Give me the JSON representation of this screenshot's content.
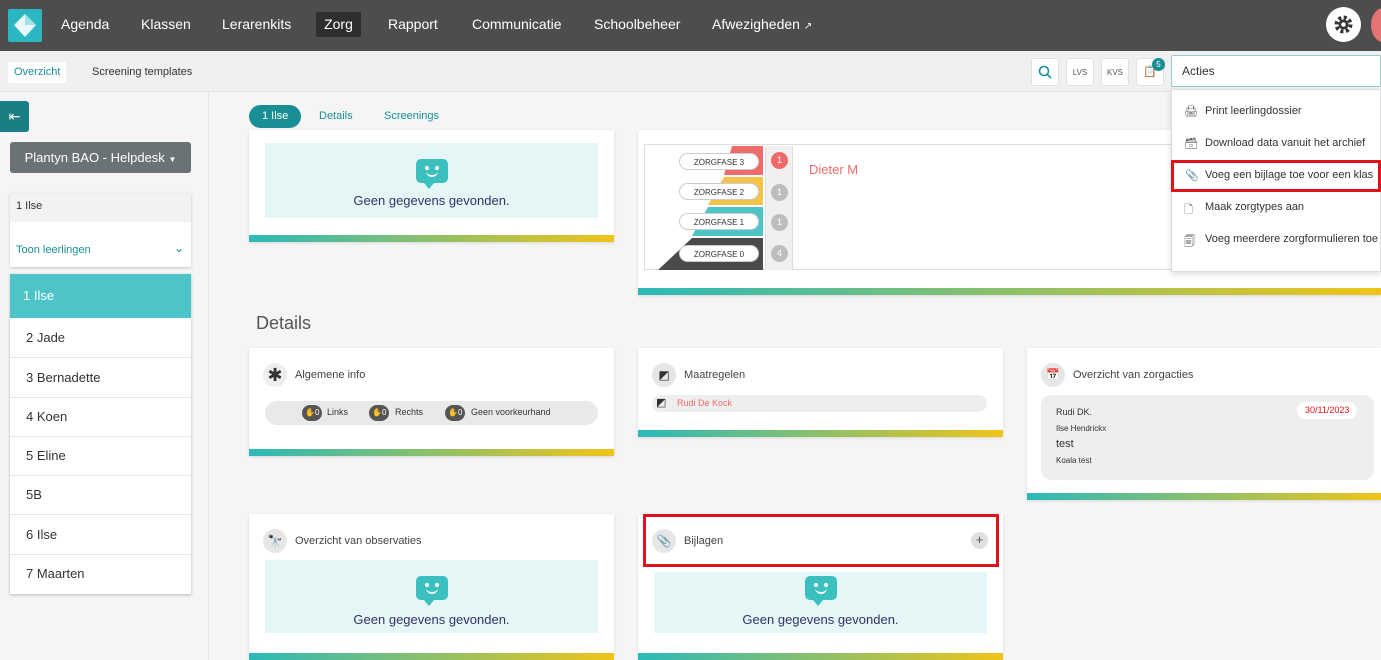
{
  "nav": {
    "items": [
      "Agenda",
      "Klassen",
      "Lerarenkits",
      "Zorg",
      "Rapport",
      "Communicatie",
      "Schoolbeheer",
      "Afwezigheden"
    ],
    "active": "Zorg",
    "external_icon": "external-link-icon"
  },
  "subnav": {
    "tabs": [
      "Overzicht",
      "Screening templates"
    ],
    "active": "Overzicht",
    "icons": {
      "search": "search-icon",
      "lvs": "LVS",
      "kvs": "KVS",
      "doc": "clipboard-icon"
    },
    "badge_count": "5",
    "acties_label": "Acties"
  },
  "acties_menu": {
    "items": [
      {
        "label": "Print leerlingdossier",
        "icon": "printer-icon"
      },
      {
        "label": "Download data vanuit het archief",
        "icon": "archive-icon"
      },
      {
        "label": "Voeg een bijlage toe voor een klas",
        "icon": "paperclip-icon",
        "highlighted": true
      },
      {
        "label": "Maak zorgtypes aan",
        "icon": "file-plus-icon"
      },
      {
        "label": "Voeg meerdere zorgformulieren toe",
        "icon": "files-icon"
      }
    ]
  },
  "sidebar": {
    "school": "Plantyn BAO - Helpdesk",
    "current_class": "1 Ilse",
    "toon_label": "Toon leerlingen",
    "classes": [
      "1 Ilse",
      "2 Jade",
      "3 Bernadette",
      "4 Koen",
      "5 Eline",
      "5B",
      "6 Ilse",
      "7 Maarten"
    ],
    "active_class": "1 Ilse"
  },
  "content_tabs": {
    "items": [
      "1 Ilse",
      "Details",
      "Screenings"
    ],
    "active": "1 Ilse"
  },
  "nodata_text": "Geen gegevens gevonden.",
  "pyramid": {
    "phases": [
      {
        "label": "ZORGFASE 3",
        "count": "1",
        "color": "#ef6b6b"
      },
      {
        "label": "ZORGFASE 2",
        "count": "1",
        "color": "#f3c34a"
      },
      {
        "label": "ZORGFASE 1",
        "count": "1",
        "color": "#4cc4c8"
      },
      {
        "label": "ZORGFASE 0",
        "count": "4",
        "color": "#4a4a4a"
      }
    ],
    "student": "Dieter M"
  },
  "details": {
    "section_title": "Details",
    "algemene": {
      "title": "Algemene info",
      "chips": [
        {
          "count": "0",
          "label": "Links"
        },
        {
          "count": "0",
          "label": "Rechts"
        },
        {
          "count": "0",
          "label": "Geen voorkeurhand"
        }
      ]
    },
    "maatregelen": {
      "title": "Maatregelen",
      "person": "Rudi De Kock"
    },
    "zorgacties": {
      "title": "Overzicht van zorgacties",
      "author": "Rudi DK.",
      "student": "Ilse Hendrickx",
      "entry": "test",
      "sub": "Koala test",
      "date": "30/11/2023"
    },
    "observaties": {
      "title": "Overzicht van observaties"
    },
    "bijlagen": {
      "title": "Bijlagen",
      "add": "+"
    }
  },
  "colors": {
    "accent": "#1a8e95",
    "highlight": "#e0111b",
    "nav_bg": "#4d4d4d"
  }
}
